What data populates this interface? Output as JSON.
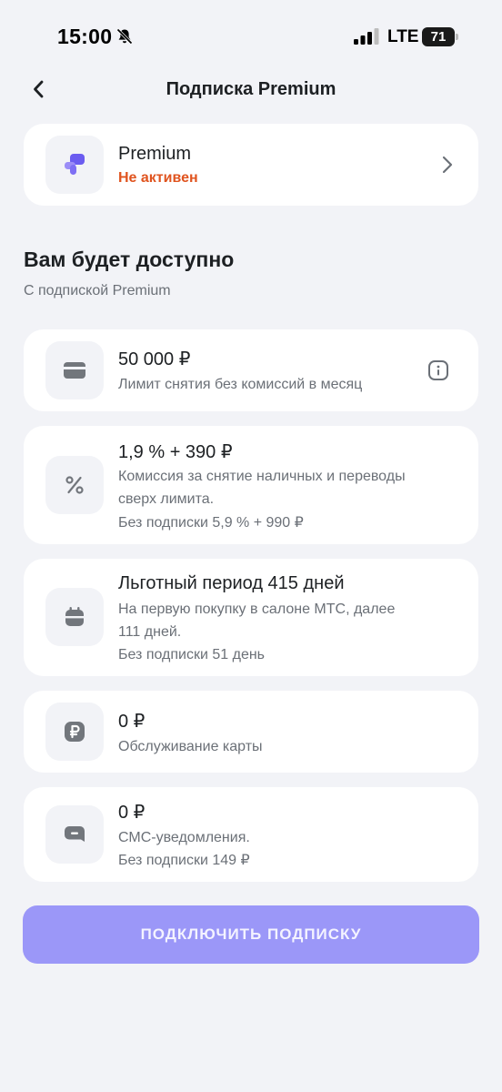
{
  "status_bar": {
    "time": "15:00",
    "network": "LTE",
    "battery": "71"
  },
  "header": {
    "title": "Подписка Premium"
  },
  "plan": {
    "name": "Premium",
    "status": "Не активен"
  },
  "section": {
    "title": "Вам будет доступно",
    "subtitle": "С подпиской Premium"
  },
  "features": [
    {
      "title": "50 000 ₽",
      "lines": [
        "Лимит снятия без комиссий в месяц"
      ],
      "icon": "card-icon"
    },
    {
      "title": "1,9 % + 390 ₽",
      "lines": [
        "Комиссия за снятие наличных и переводы",
        "сверх лимита.",
        "Без подписки 5,9 % + 990 ₽"
      ],
      "icon": "percent-icon"
    },
    {
      "title": "Льготный период 415 дней",
      "lines": [
        "На первую покупку в салоне МТС, далее",
        "111 дней.",
        "Без подписки 51 день"
      ],
      "icon": "calendar-icon"
    },
    {
      "title": "0 ₽",
      "lines": [
        "Обслуживание карты"
      ],
      "icon": "ruble-icon"
    },
    {
      "title": "0 ₽",
      "lines": [
        "СМС-уведомления.",
        "Без подписки 149 ₽"
      ],
      "icon": "message-icon"
    }
  ],
  "cta": {
    "label": "подключить подписку"
  },
  "colors": {
    "accent": "#9b97f8",
    "status_inactive": "#e0541f",
    "background": "#f2f3f7",
    "icon_gray": "#72767c"
  }
}
